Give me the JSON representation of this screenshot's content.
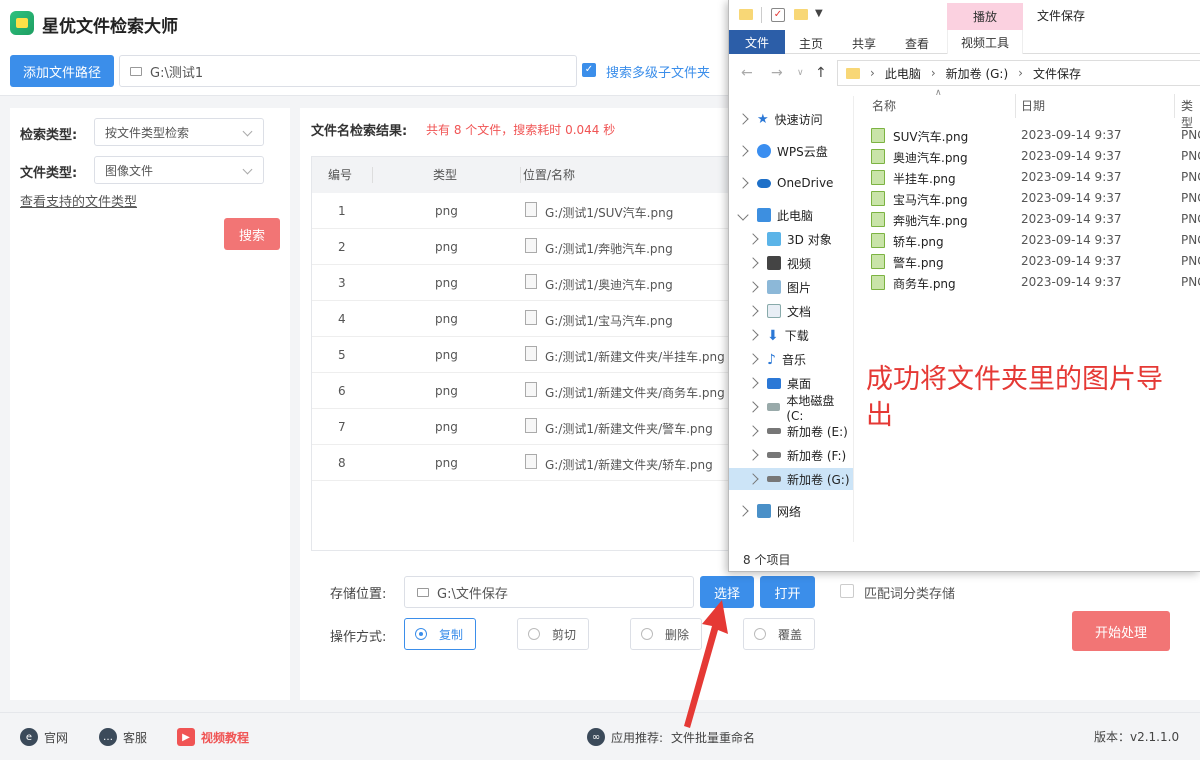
{
  "app": {
    "title": "星优文件检索大师"
  },
  "path_bar": {
    "add_button": "添加文件路径",
    "path_value": "G:\\测试1",
    "multi_level_label": "搜索多级子文件夹",
    "multi_level_checked": true
  },
  "left": {
    "search_type_label": "检索类型:",
    "search_type_value": "按文件类型检索",
    "file_type_label": "文件类型:",
    "file_type_value": "图像文件",
    "support_link": "查看支持的文件类型",
    "search_button": "搜索"
  },
  "results": {
    "title": "文件名检索结果:",
    "summary": "共有 8 个文件，搜索耗时 0.044 秒",
    "headers": {
      "num": "编号",
      "type": "类型",
      "path": "位置/名称"
    },
    "rows": [
      {
        "num": "1",
        "type": "png",
        "path": "G:/测试1/SUV汽车.png"
      },
      {
        "num": "2",
        "type": "png",
        "path": "G:/测试1/奔驰汽车.png"
      },
      {
        "num": "3",
        "type": "png",
        "path": "G:/测试1/奥迪汽车.png"
      },
      {
        "num": "4",
        "type": "png",
        "path": "G:/测试1/宝马汽车.png"
      },
      {
        "num": "5",
        "type": "png",
        "path": "G:/测试1/新建文件夹/半挂车.png"
      },
      {
        "num": "6",
        "type": "png",
        "path": "G:/测试1/新建文件夹/商务车.png"
      },
      {
        "num": "7",
        "type": "png",
        "path": "G:/测试1/新建文件夹/警车.png"
      },
      {
        "num": "8",
        "type": "png",
        "path": "G:/测试1/新建文件夹/轿车.png"
      }
    ]
  },
  "bottom": {
    "storage_label": "存储位置:",
    "storage_value": "G:\\文件保存",
    "select_button": "选择",
    "open_button": "打开",
    "match_label": "匹配词分类存储",
    "op_label": "操作方式:",
    "ops": [
      "复制",
      "剪切",
      "删除",
      "覆盖"
    ],
    "selected_op": "复制",
    "start_button": "开始处理"
  },
  "footer": {
    "official": "官网",
    "service": "客服",
    "video": "视频教程",
    "recommend_label": "应用推荐:",
    "recommend_value": "文件批量重命名",
    "version": "版本：v2.1.1.0"
  },
  "explorer": {
    "context_tab": "播放",
    "window_title": "文件保存",
    "tabs": {
      "file": "文件",
      "home": "主页",
      "share": "共享",
      "view": "查看",
      "video_tools": "视频工具"
    },
    "breadcrumb": [
      "此电脑",
      "新加卷 (G:)",
      "文件保存"
    ],
    "nav": {
      "quick": "快速访问",
      "wps": "WPS云盘",
      "onedrive": "OneDrive",
      "pc": "此电脑",
      "obj3d": "3D 对象",
      "video": "视频",
      "pictures": "图片",
      "docs": "文档",
      "download": "下载",
      "music": "音乐",
      "desktop": "桌面",
      "local_c": "本地磁盘 (C:",
      "vol_e": "新加卷 (E:)",
      "vol_f": "新加卷 (F:)",
      "vol_g": "新加卷 (G:)",
      "network": "网络"
    },
    "columns": {
      "name": "名称",
      "date": "日期",
      "type": "类型"
    },
    "files": [
      {
        "name": "SUV汽车.png",
        "date": "2023-09-14 9:37",
        "type": "PNG"
      },
      {
        "name": "奥迪汽车.png",
        "date": "2023-09-14 9:37",
        "type": "PNG"
      },
      {
        "name": "半挂车.png",
        "date": "2023-09-14 9:37",
        "type": "PNG"
      },
      {
        "name": "宝马汽车.png",
        "date": "2023-09-14 9:37",
        "type": "PNG"
      },
      {
        "name": "奔驰汽车.png",
        "date": "2023-09-14 9:37",
        "type": "PNG"
      },
      {
        "name": "轿车.png",
        "date": "2023-09-14 9:37",
        "type": "PNG"
      },
      {
        "name": "警车.png",
        "date": "2023-09-14 9:37",
        "type": "PNG"
      },
      {
        "name": "商务车.png",
        "date": "2023-09-14 9:37",
        "type": "PNG"
      }
    ],
    "status": "8 个项目"
  },
  "annotation": {
    "text": "成功将文件夹里的图片导出"
  },
  "colors": {
    "accent_blue": "#3b8eea",
    "accent_red": "#f27575",
    "explorer_blue": "#2c5ea8"
  }
}
